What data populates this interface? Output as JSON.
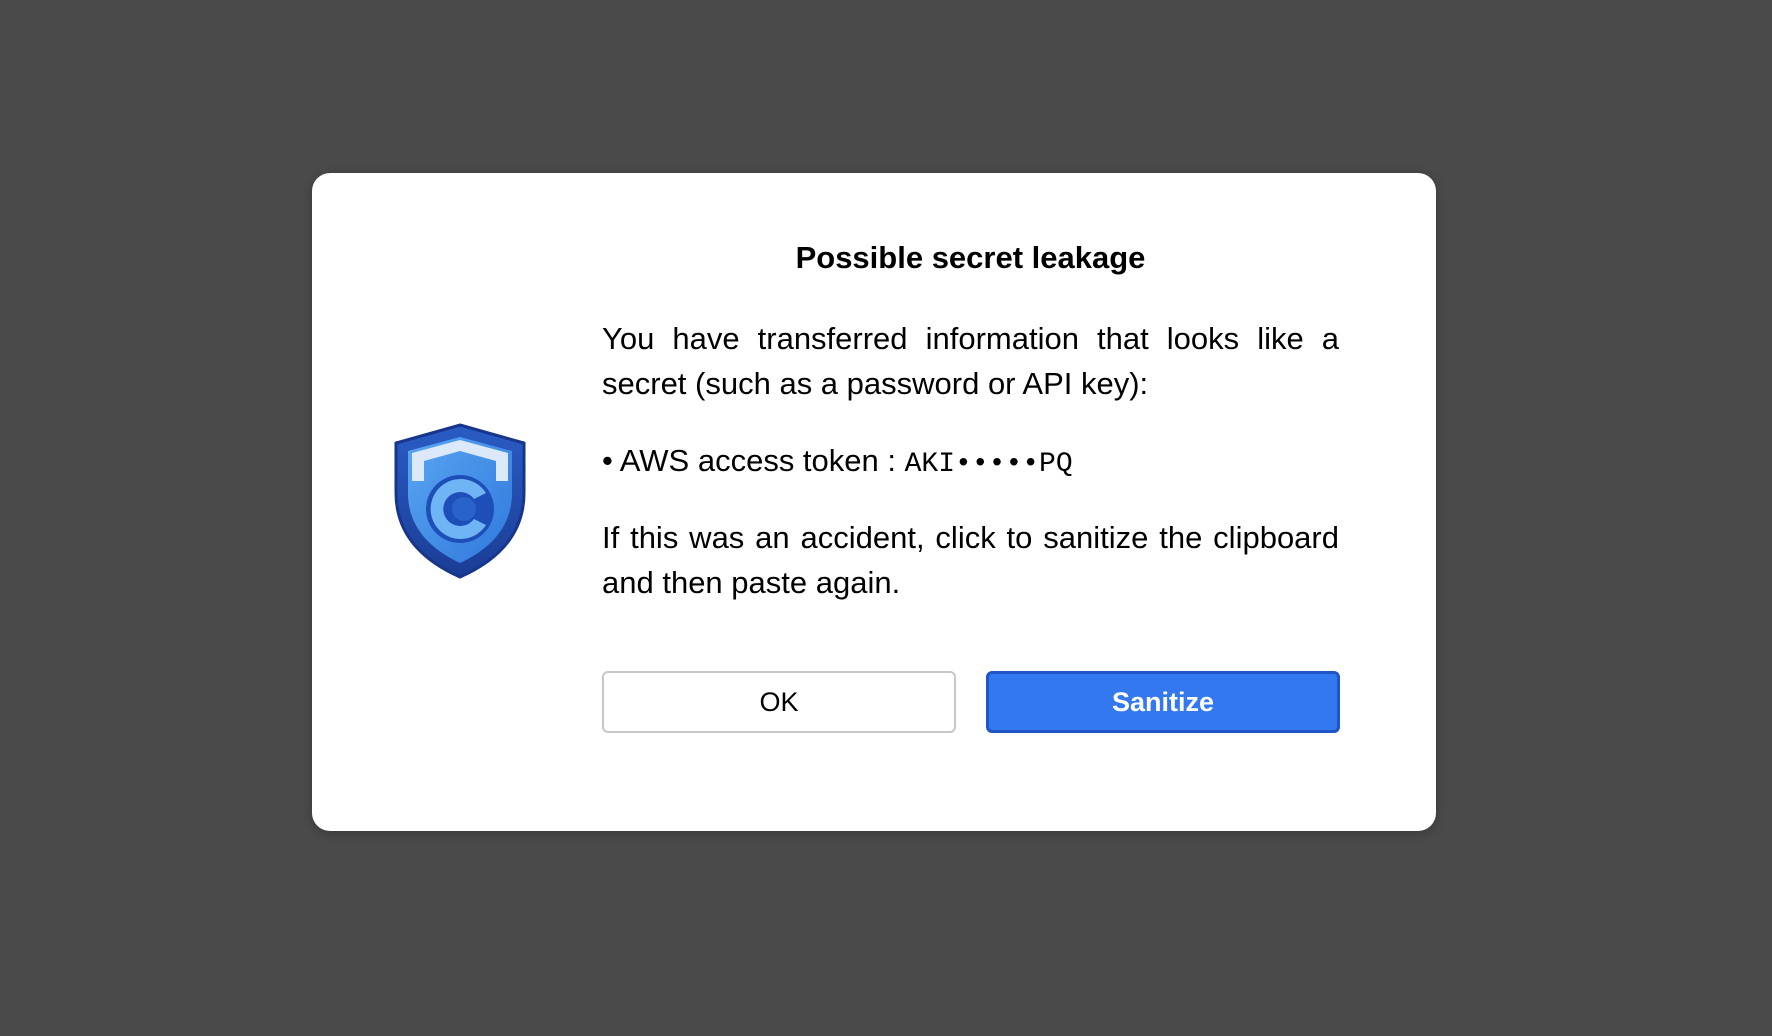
{
  "dialog": {
    "title": "Possible secret leakage",
    "intro": "You have transferred information that looks like a secret (such as a password or API key):",
    "secrets": [
      {
        "bullet": "•",
        "label": "AWS access token",
        "separator": " : ",
        "value": "AKI•••••PQ"
      }
    ],
    "instruction": "If this was an accident, click to sanitize the clipboard and then paste again.",
    "buttons": {
      "ok_label": "OK",
      "sanitize_label": "Sanitize"
    },
    "logo_icon": "shield-icon",
    "colors": {
      "overlay": "#4a4a4a",
      "primary_button": "#3478f0",
      "primary_button_border": "#1f55c4",
      "shield_dark": "#1e47a8",
      "shield_light": "#3d8be8"
    }
  }
}
